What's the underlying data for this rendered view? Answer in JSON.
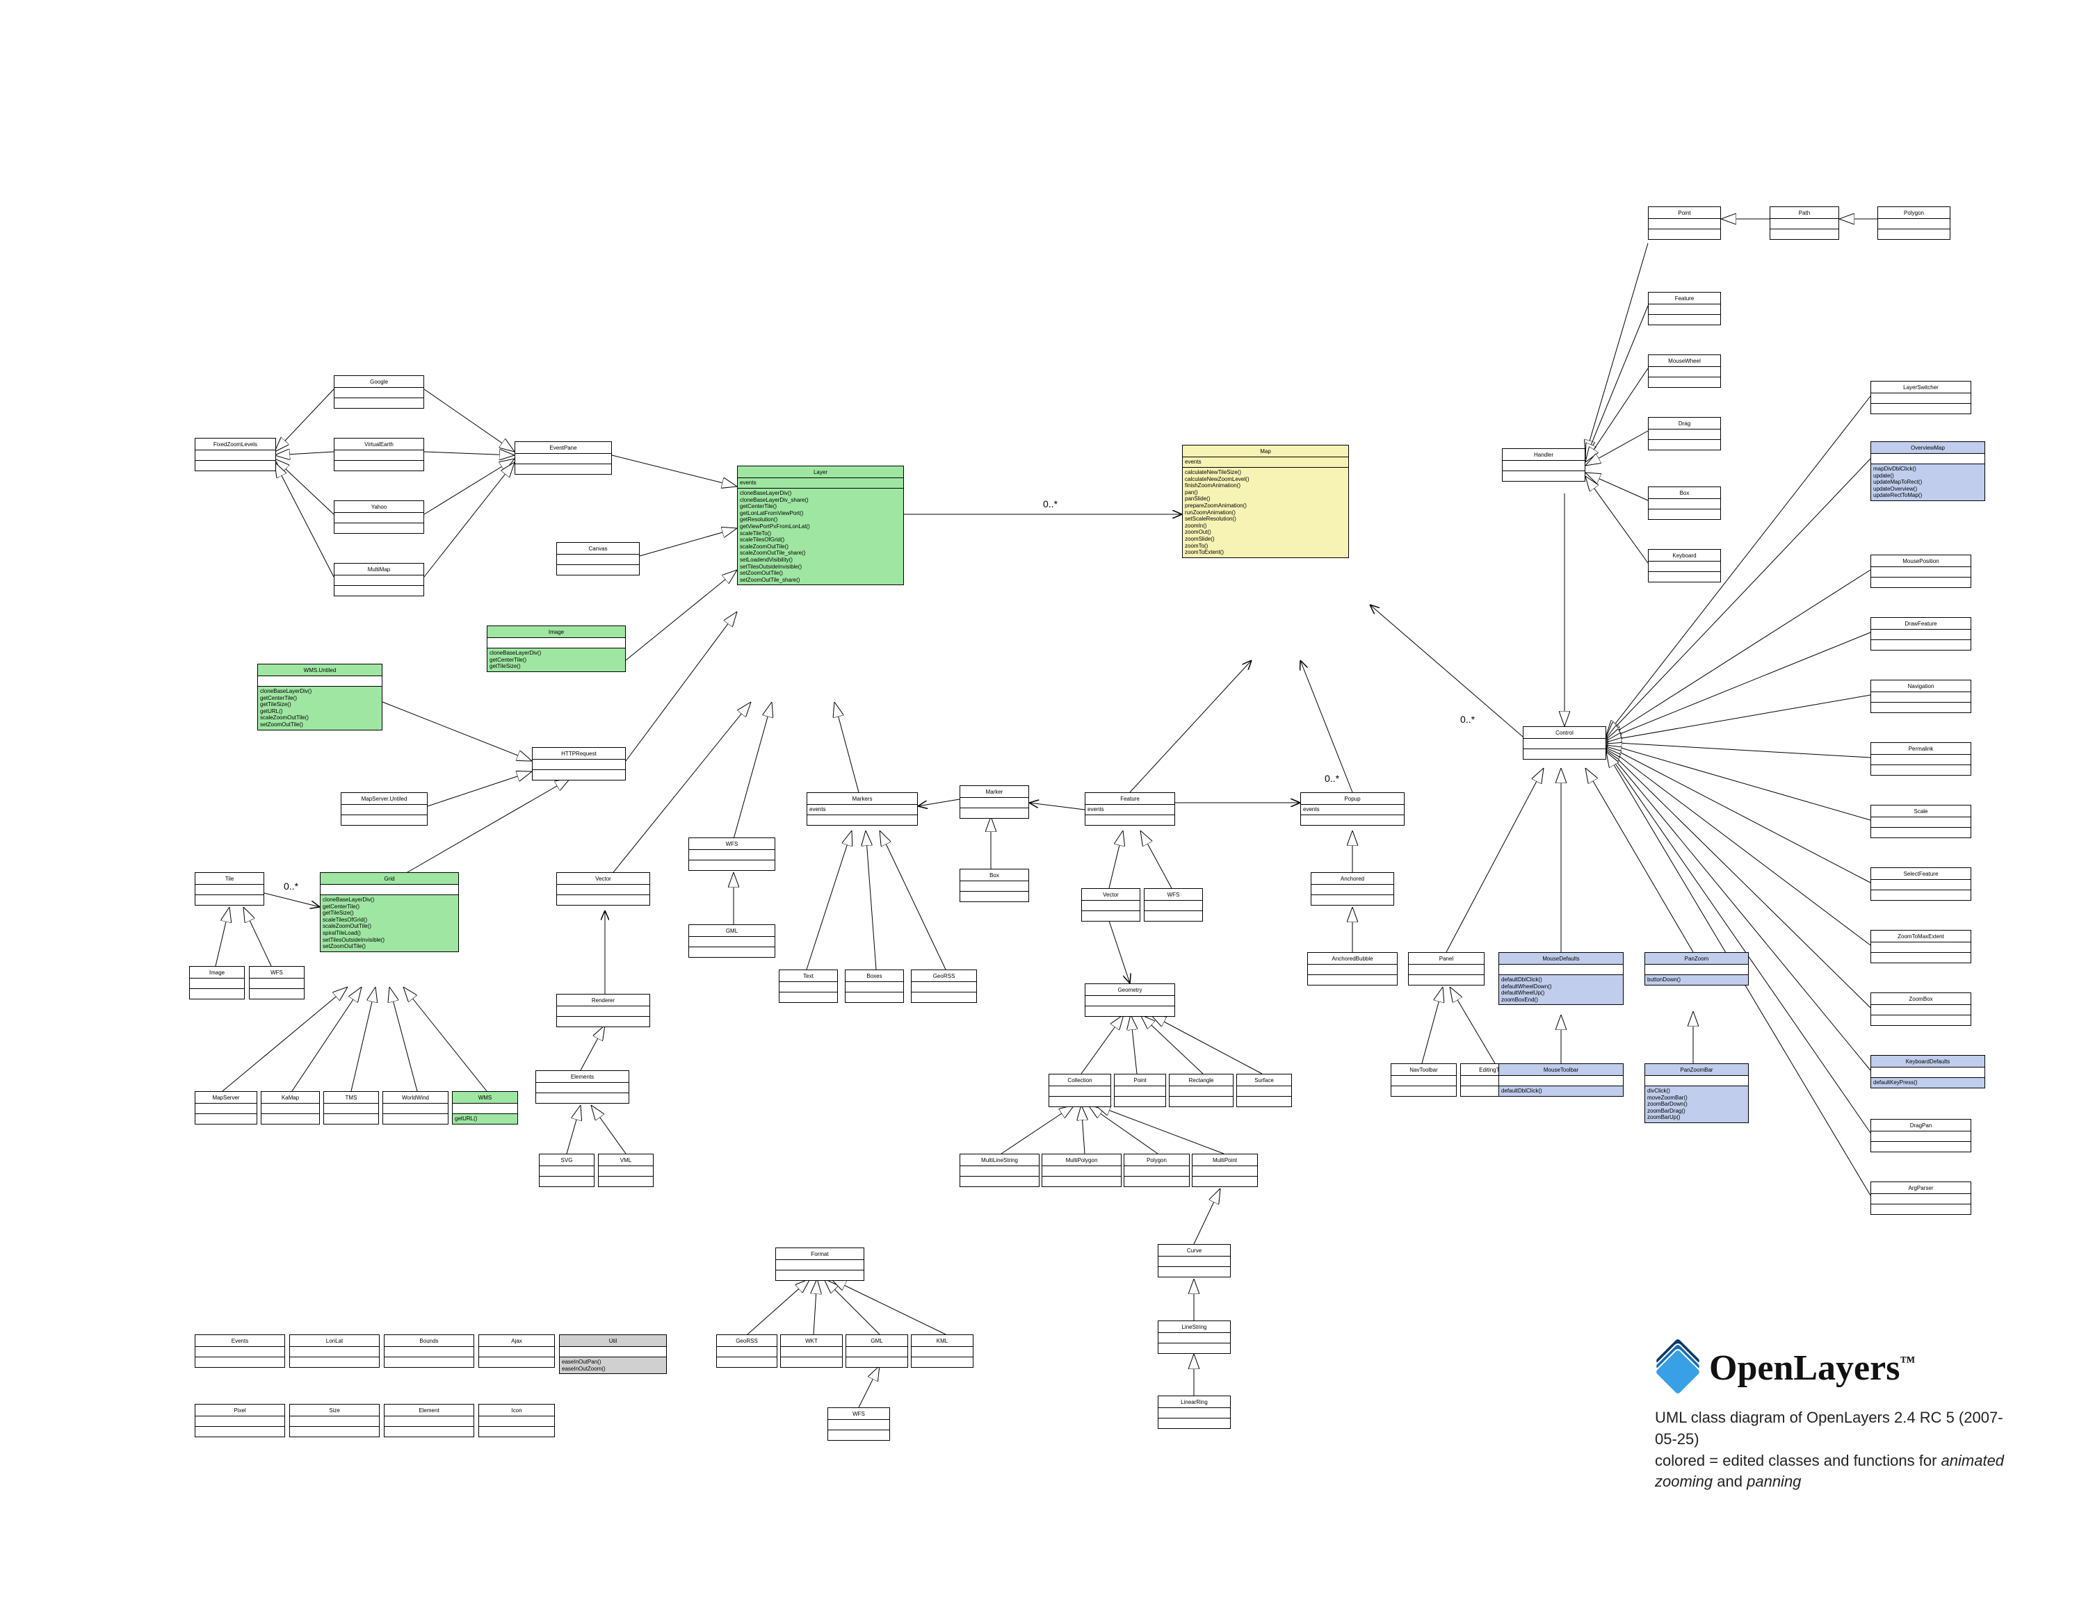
{
  "brand": {
    "name": "OpenLayers",
    "tm": "™"
  },
  "caption": {
    "line1": "UML class diagram of OpenLayers 2.4 RC 5 (2007-05-25)",
    "line2_prefix": "colored = edited classes and functions for ",
    "line2_em1": "animated zooming",
    "line2_mid": " and ",
    "line2_em2": "panning"
  },
  "edge_labels": {
    "zero_many": "0..*"
  },
  "classes": {
    "FixedZoomLevels": {
      "title": "FixedZoomLevels"
    },
    "Google": {
      "title": "Google"
    },
    "VirtualEarth": {
      "title": "VirtualEarth"
    },
    "Yahoo": {
      "title": "Yahoo"
    },
    "MultiMap": {
      "title": "MultiMap"
    },
    "EventPane": {
      "title": "EventPane"
    },
    "Canvas": {
      "title": "Canvas"
    },
    "Image": {
      "title": "Image",
      "methods": [
        "cloneBaseLayerDiv()",
        "getCenterTile()",
        "getTileSize()"
      ]
    },
    "HTTPRequest": {
      "title": "HTTPRequest"
    },
    "WMSUntiled": {
      "title": "WMS.Untiled",
      "methods": [
        "cloneBaseLayerDiv()",
        "getCenterTile()",
        "getTileSize()",
        "getURL()",
        "scaleZoomOutTile()",
        "setZoomOutTile()"
      ]
    },
    "MapServerUntiled": {
      "title": "MapServer.Untiled"
    },
    "Tile": {
      "title": "Tile"
    },
    "TileImage": {
      "title": "Image"
    },
    "TileWFS": {
      "title": "WFS"
    },
    "Grid": {
      "title": "Grid",
      "methods": [
        "cloneBaseLayerDiv()",
        "getCenterTile()",
        "getTileSize()",
        "scaleTilesOfGrid()",
        "scaleZoomOutTile()",
        "spiralTileLoad()",
        "setTilesOutsideInvisible()",
        "setZoomOutTile()"
      ]
    },
    "MapServer": {
      "title": "MapServer"
    },
    "KaMap": {
      "title": "KaMap"
    },
    "TMS": {
      "title": "TMS"
    },
    "WorldWind": {
      "title": "WorldWind"
    },
    "WMS": {
      "title": "WMS",
      "methods": [
        "getURL()"
      ]
    },
    "Layer": {
      "title": "Layer",
      "attrs": [
        "events"
      ],
      "methods": [
        "cloneBaseLayerDiv()",
        "cloneBaseLayerDiv_share()",
        "getCenterTile()",
        "getLonLatFromViewPort()",
        "getResolution()",
        "getViewPortPxFromLonLat()",
        "scaleTileTo()",
        "scaleTilesOfGrid()",
        "scaleZoomOutTile()",
        "scaleZoomOutTile_share()",
        "setLoadendVisibility()",
        "setTilesOutsideInvisible()",
        "setZoomOutTile()",
        "setZoomOutTile_share()"
      ]
    },
    "Map": {
      "title": "Map",
      "attrs": [
        "events"
      ],
      "methods": [
        "calculateNewTileSize()",
        "calculateNewZoomLevel()",
        "finishZoomAnimation()",
        "pan()",
        "panSlide()",
        "prepareZoomAnimation()",
        "runZoomAnimation()",
        "setScaleResolution()",
        "zoomIn()",
        "zoomOut()",
        "zoomSlide()",
        "zoomTo()",
        "zoomToExtent()"
      ]
    },
    "Vector": {
      "title": "Vector"
    },
    "Renderer": {
      "title": "Renderer"
    },
    "Elements": {
      "title": "Elements"
    },
    "SVG": {
      "title": "SVG"
    },
    "VML": {
      "title": "VML"
    },
    "WFS": {
      "title": "WFS"
    },
    "GML": {
      "title": "GML"
    },
    "Markers": {
      "title": "Markers",
      "attrs": [
        "events"
      ]
    },
    "Text": {
      "title": "Text"
    },
    "Boxes": {
      "title": "Boxes"
    },
    "GeoRSS": {
      "title": "GeoRSS"
    },
    "Marker": {
      "title": "Marker"
    },
    "Box": {
      "title": "Box"
    },
    "Feature": {
      "title": "Feature",
      "attrs": [
        "events"
      ]
    },
    "FVector": {
      "title": "Vector"
    },
    "FWFS": {
      "title": "WFS"
    },
    "Popup": {
      "title": "Popup",
      "attrs": [
        "events"
      ]
    },
    "Anchored": {
      "title": "Anchored"
    },
    "AnchoredBubble": {
      "title": "AnchoredBubble"
    },
    "Geometry": {
      "title": "Geometry"
    },
    "Collection": {
      "title": "Collection"
    },
    "GPoint": {
      "title": "Point"
    },
    "Rectangle": {
      "title": "Rectangle"
    },
    "Surface": {
      "title": "Surface"
    },
    "MultiLineString": {
      "title": "MultiLineString"
    },
    "MultiPolygon": {
      "title": "MultiPolygon"
    },
    "GPolygon": {
      "title": "Polygon"
    },
    "MultiPoint": {
      "title": "MultiPoint"
    },
    "Curve": {
      "title": "Curve"
    },
    "LineString": {
      "title": "LineString"
    },
    "LinearRing": {
      "title": "LinearRing"
    },
    "Format": {
      "title": "Format"
    },
    "FGeoRSS": {
      "title": "GeoRSS"
    },
    "WKT": {
      "title": "WKT"
    },
    "FGML": {
      "title": "GML"
    },
    "KML": {
      "title": "KML"
    },
    "FWFS2": {
      "title": "WFS"
    },
    "Handler": {
      "title": "Handler"
    },
    "HPoint": {
      "title": "Point"
    },
    "HPath": {
      "title": "Path"
    },
    "HPolygon": {
      "title": "Polygon"
    },
    "HFeature": {
      "title": "Feature"
    },
    "MouseWheel": {
      "title": "MouseWheel"
    },
    "Drag": {
      "title": "Drag"
    },
    "HBox": {
      "title": "Box"
    },
    "Keyboard": {
      "title": "Keyboard"
    },
    "Control": {
      "title": "Control"
    },
    "LayerSwitcher": {
      "title": "LayerSwitcher"
    },
    "OverviewMap": {
      "title": "OverviewMap",
      "methods": [
        "mapDivDblClick()",
        "update()",
        "updateMapToRect()",
        "updateOverview()",
        "updateRectToMap()"
      ]
    },
    "MousePosition": {
      "title": "MousePosition"
    },
    "DrawFeature": {
      "title": "DrawFeature"
    },
    "Navigation": {
      "title": "Navigation"
    },
    "Permalink": {
      "title": "Permalink"
    },
    "Scale": {
      "title": "Scale"
    },
    "SelectFeature": {
      "title": "SelectFeature"
    },
    "ZoomToMaxExtent": {
      "title": "ZoomToMaxExtent"
    },
    "ZoomBox": {
      "title": "ZoomBox"
    },
    "KeyboardDefaults": {
      "title": "KeyboardDefaults",
      "methods": [
        "defaultKeyPress()"
      ]
    },
    "DragPan": {
      "title": "DragPan"
    },
    "ArgParser": {
      "title": "ArgParser"
    },
    "Panel": {
      "title": "Panel"
    },
    "MouseDefaults": {
      "title": "MouseDefaults",
      "methods": [
        "defaultDblClick()",
        "defaultWheelDown()",
        "defaultWheelUp()",
        "zoomBoxEnd()"
      ]
    },
    "PanZoom": {
      "title": "PanZoom",
      "methods": [
        "buttonDown()"
      ]
    },
    "NavToolbar": {
      "title": "NavToolbar"
    },
    "EditingToolbar": {
      "title": "EditingToolbar"
    },
    "MouseToolbar": {
      "title": "MouseToolbar",
      "methods": [
        "defaultDblClick()"
      ]
    },
    "PanZoomBar": {
      "title": "PanZoomBar",
      "methods": [
        "divClick()",
        "moveZoomBar()",
        "zoomBarDown()",
        "zoomBarDrag()",
        "zoomBarUp()"
      ]
    },
    "Events": {
      "title": "Events"
    },
    "LonLat": {
      "title": "LonLat"
    },
    "Bounds": {
      "title": "Bounds"
    },
    "Ajax": {
      "title": "Ajax"
    },
    "Util": {
      "title": "Util",
      "methods": [
        "easeInOutPan()",
        "easeInOutZoom()"
      ]
    },
    "Pixel": {
      "title": "Pixel"
    },
    "Size": {
      "title": "Size"
    },
    "Element": {
      "title": "Element"
    },
    "Icon": {
      "title": "Icon"
    }
  }
}
